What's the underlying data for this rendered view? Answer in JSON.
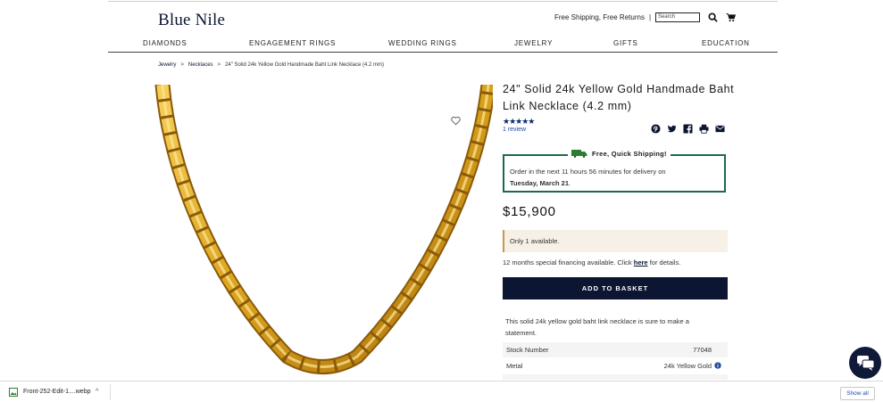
{
  "header": {
    "logo": "Blue Nile",
    "free_shipping": "Free Shipping, Free Returns",
    "separator": "|",
    "search_placeholder": "Search"
  },
  "nav": {
    "items": [
      "DIAMONDS",
      "ENGAGEMENT RINGS",
      "WEDDING RINGS",
      "JEWELRY",
      "GIFTS",
      "EDUCATION"
    ]
  },
  "breadcrumb": {
    "items": [
      "Jewelry",
      "Necklaces",
      "24\" Solid 24k Yellow Gold Handmade Baht Link Necklace (4.2 mm)"
    ],
    "separator": ">"
  },
  "product": {
    "title": "24\" Solid 24k Yellow Gold Handmade Baht Link Necklace (4.2 mm)",
    "rating_stars": 5,
    "stars_text": "★★★★★",
    "reviews": "1 review",
    "shipping_heading": "Free, Quick Shipping!",
    "order_text_prefix": "Order in the next 11 hours 56 minutes for delivery on",
    "delivery_date": "Tuesday, March 21",
    "delivery_suffix": ".",
    "price": "$15,900",
    "availability": "Only 1 available.",
    "financing_prefix": "12 months special financing available. Click",
    "financing_link": "here",
    "financing_suffix": "for details.",
    "add_to_basket": "ADD TO BASKET",
    "description": "This solid 24k yellow gold baht link necklace is sure to make a statement.",
    "specs": [
      {
        "label": "Stock Number",
        "value": "77048"
      },
      {
        "label": "Metal",
        "value": "24k Yellow Gold"
      }
    ]
  },
  "share_icons": [
    "pinterest-icon",
    "twitter-icon",
    "facebook-icon",
    "print-icon",
    "email-icon"
  ],
  "download_bar": {
    "file_name": "Front-252-Edit-1....webp",
    "show_all": "Show all"
  },
  "colors": {
    "brand_navy": "#0c1532",
    "gold": "#d9a21d",
    "ship_border": "#1c6a4b",
    "availability_bg": "#f6f0e6"
  }
}
